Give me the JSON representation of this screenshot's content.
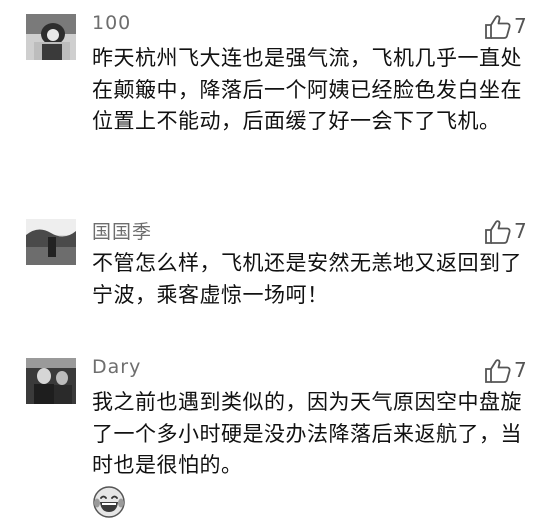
{
  "comments": [
    {
      "username": "100",
      "like_count": "7",
      "text": "昨天杭州飞大连也是强气流，飞机几乎一直处在颠簸中，降落后一个阿姨已经脸色发白坐在位置上不能动，后面缓了好一会下了飞机。"
    },
    {
      "username": "国国季",
      "like_count": "7",
      "text": "不管怎么样，飞机还是安然无恙地又返回到了宁波，乘客虚惊一场呵！"
    },
    {
      "username": "Dary",
      "like_count": "7",
      "text": "我之前也遇到类似的，因为天气原因空中盘旋了一个多小时硬是没办法降落后来返航了，当时也是很怕的。",
      "emoji": "laughing-crying-emoji"
    }
  ],
  "icons": {
    "like": "thumbs-up-icon"
  }
}
